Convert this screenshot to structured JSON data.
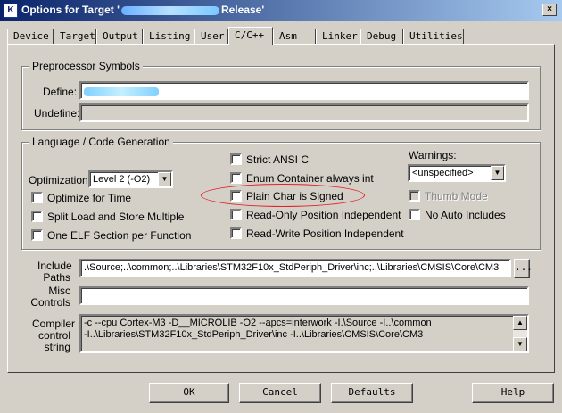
{
  "window": {
    "title_prefix": "Options for Target '",
    "title_suffix": "Release'",
    "close_glyph": "×"
  },
  "tabs": [
    {
      "label": "Device"
    },
    {
      "label": "Target"
    },
    {
      "label": "Output"
    },
    {
      "label": "Listing"
    },
    {
      "label": "User"
    },
    {
      "label": "C/C++",
      "active": true
    },
    {
      "label": "Asm"
    },
    {
      "label": "Linker"
    },
    {
      "label": "Debug"
    },
    {
      "label": "Utilities"
    }
  ],
  "preprocessor": {
    "group_title": "Preprocessor Symbols",
    "define_label": "Define:",
    "define_value": "",
    "undefine_label": "Undefine:",
    "undefine_value": ""
  },
  "language": {
    "group_title": "Language / Code Generation",
    "optimization_label": "Optimization:",
    "optimization_value": "Level 2 (-O2)",
    "checkboxes_left": [
      {
        "label": "Optimize for Time",
        "checked": false
      },
      {
        "label": "Split Load and Store Multiple",
        "checked": false
      },
      {
        "label": "One ELF Section per Function",
        "checked": false
      }
    ],
    "checkboxes_middle": [
      {
        "label": "Strict ANSI C",
        "checked": false
      },
      {
        "label": "Enum Container always int",
        "checked": false
      },
      {
        "label": "Plain Char is Signed",
        "checked": false
      },
      {
        "label": "Read-Only Position Independent",
        "checked": false
      },
      {
        "label": "Read-Write Position Independent",
        "checked": false
      }
    ],
    "warnings_label": "Warnings:",
    "warnings_value": "<unspecified>",
    "checkboxes_right": [
      {
        "label": "Thumb Mode",
        "checked": false,
        "disabled": true
      },
      {
        "label": "No Auto Includes",
        "checked": false
      }
    ]
  },
  "include": {
    "label_line1": "Include",
    "label_line2": "Paths",
    "value": ".\\Source;..\\common;..\\Libraries\\STM32F10x_StdPeriph_Driver\\inc;..\\Libraries\\CMSIS\\Core\\CM3",
    "browse_label": "..."
  },
  "misc": {
    "label_line1": "Misc",
    "label_line2": "Controls",
    "value": ""
  },
  "compiler": {
    "label_line1": "Compiler",
    "label_line2": "control",
    "label_line3": "string",
    "line1": "-c --cpu Cortex-M3 -D__MICROLIB -O2 --apcs=interwork -I.\\Source -I..\\common",
    "line2": "-I..\\Libraries\\STM32F10x_StdPeriph_Driver\\inc -I..\\Libraries\\CMSIS\\Core\\CM3"
  },
  "buttons": {
    "ok": "OK",
    "cancel": "Cancel",
    "defaults": "Defaults",
    "help": "Help"
  },
  "colors": {
    "annotation": "#e0202a",
    "titlebar_start": "#0a246a",
    "titlebar_end": "#a6caf0"
  }
}
